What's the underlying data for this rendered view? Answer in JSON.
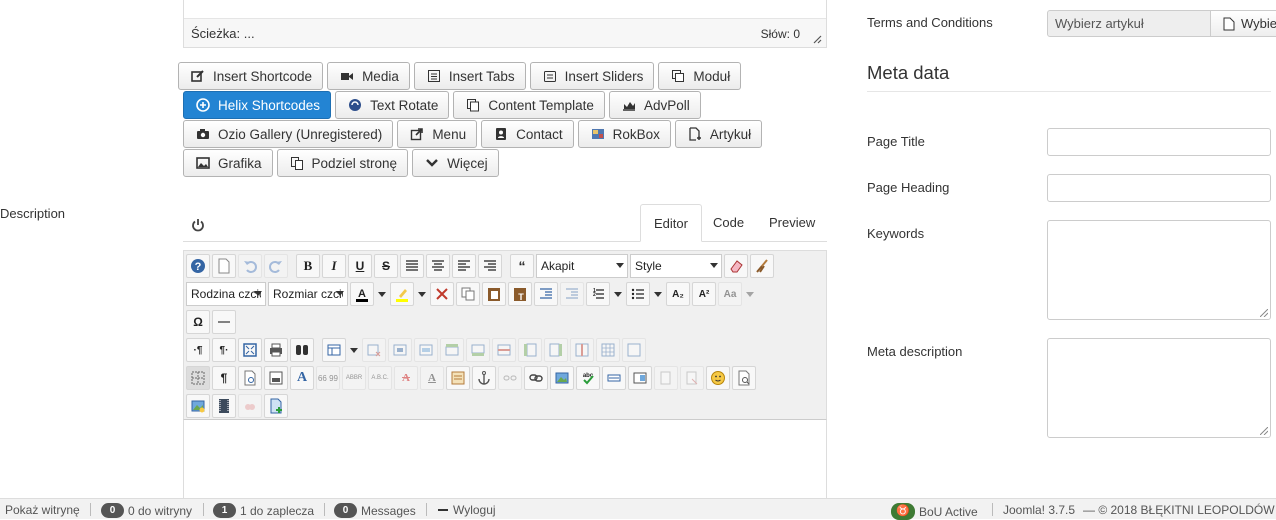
{
  "editor_status": {
    "path_label": "Ścieżka: ...",
    "word_count": "Słów: 0"
  },
  "extension_buttons": [
    [
      {
        "label": "Insert Shortcode",
        "icon": "edit-icon"
      },
      {
        "label": "Media",
        "icon": "camera-icon"
      },
      {
        "label": "Insert Tabs",
        "icon": "list-icon"
      },
      {
        "label": "Insert Sliders",
        "icon": "sliders-icon"
      },
      {
        "label": "Moduł",
        "icon": "module-icon"
      }
    ],
    [
      {
        "label": "Helix Shortcodes",
        "icon": "plus-circle-icon",
        "primary": true
      },
      {
        "label": "Text Rotate",
        "icon": "rotate-icon"
      },
      {
        "label": "Content Template",
        "icon": "template-icon"
      },
      {
        "label": "AdvPoll",
        "icon": "chart-icon"
      }
    ],
    [
      {
        "label": "Ozio Gallery (Unregistered)",
        "icon": "camera-icon"
      },
      {
        "label": "Menu",
        "icon": "share-icon"
      },
      {
        "label": "Contact",
        "icon": "address-book-icon"
      },
      {
        "label": "RokBox",
        "icon": "rokbox-icon"
      },
      {
        "label": "Artykuł",
        "icon": "file-add-icon"
      }
    ],
    [
      {
        "label": "Grafika",
        "icon": "picture-icon"
      },
      {
        "label": "Podziel stronę",
        "icon": "copy-icon"
      },
      {
        "label": "Więcej",
        "icon": "chevron-down-icon"
      }
    ]
  ],
  "left_label": "Description",
  "editor_tabs": [
    "Editor",
    "Code",
    "Preview"
  ],
  "toolbar": {
    "paragraph_select": "Akapit",
    "style_select": "Style",
    "font_family_select": "Rodzina czcio",
    "font_size_select": "Rozmiar czcio"
  },
  "right_panel": {
    "terms_label": "Terms and Conditions",
    "terms_placeholder": "Wybierz artykuł",
    "terms_button": "Wybie",
    "meta_title": "Meta data",
    "fields": [
      "Page Title",
      "Page Heading",
      "Keywords",
      "Meta description"
    ]
  },
  "footer": {
    "view_site": "Pokaż witrynę",
    "site_badge": "0",
    "site_label": "0 do witryny",
    "admin_badge": "1",
    "admin_label": "1 do zaplecza",
    "messages_badge": "0",
    "messages_label": "Messages",
    "logout": "Wyloguj",
    "bou": "BoU Active",
    "version": "Joomla! 3.7.5",
    "copyright": "— © 2018 BŁĘKITNI LEOPOLDÓW"
  }
}
